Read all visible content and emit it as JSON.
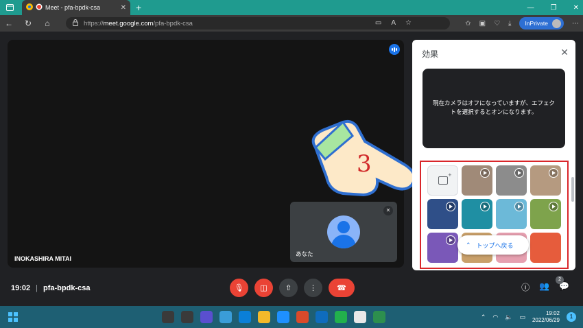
{
  "browser": {
    "tab_title": "Meet - pfa-bpdk-csa",
    "tab_close": "✕",
    "new_tab": "+",
    "url_protocol": "https://",
    "url_host": "meet.google.com",
    "url_path": "/pfa-bpdk-csa",
    "inprivate_label": "InPrivate",
    "window_min": "—",
    "window_restore": "❐",
    "window_close": "✕"
  },
  "meeting": {
    "main_participant": "INOKASHIRA MITAI",
    "self_label": "あなた",
    "time": "19:02",
    "separator": "|",
    "code": "pfa-bpdk-csa",
    "participants_count": "2"
  },
  "effects_panel": {
    "title": "効果",
    "close": "✕",
    "preview_text": "現在カメラはオフになっていますが、エフェクトを選択するとオンになります。",
    "back_to_top": "トップへ戻る",
    "tiles": [
      {
        "kind": "upload",
        "color": "#f1f3f4",
        "play": false
      },
      {
        "kind": "bg",
        "color": "#a08a78",
        "play": true
      },
      {
        "kind": "bg",
        "color": "#8c8c8c",
        "play": true
      },
      {
        "kind": "bg",
        "color": "#b59a80",
        "play": true
      },
      {
        "kind": "bg",
        "color": "#2f4f88",
        "play": true
      },
      {
        "kind": "bg",
        "color": "#1f8fa3",
        "play": true
      },
      {
        "kind": "bg",
        "color": "#6cb9d8",
        "play": true
      },
      {
        "kind": "bg",
        "color": "#7ea34c",
        "play": true
      },
      {
        "kind": "bg",
        "color": "#7a58b8",
        "play": true
      },
      {
        "kind": "bg",
        "color": "#c9a06a",
        "play": false
      },
      {
        "kind": "bg",
        "color": "#e6a0b0",
        "play": false
      },
      {
        "kind": "bg",
        "color": "#e65c3c",
        "play": false
      }
    ]
  },
  "annotation": {
    "number": "3"
  },
  "taskbar": {
    "time": "19:02",
    "date": "2022/06/29",
    "notifications": "1",
    "apps": [
      "#3a3a3a",
      "#3a3a3a",
      "#5a4fcf",
      "#3a9dd8",
      "#0a7fd8",
      "#f3b92a",
      "#1e90ff",
      "#d94a2a",
      "#0f6cbd",
      "#22b14c",
      "#e8e8e8",
      "#2d8f4e"
    ]
  }
}
